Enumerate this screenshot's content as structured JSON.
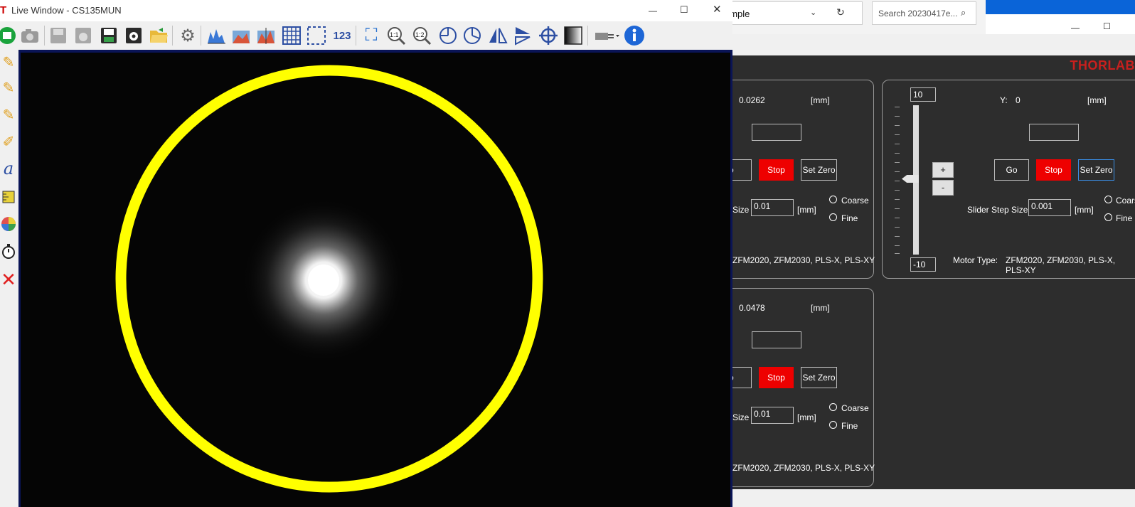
{
  "live_window": {
    "title": "Live Window - CS135MUN",
    "app_icon": "T",
    "controls": {
      "minimize": "—",
      "maximize": "☐",
      "close": "✕"
    },
    "toolbar_icons": [
      "start-live-icon",
      "snapshot-camera-icon",
      "save-disabled-icon",
      "save-sequence-disabled-icon",
      "save-image-icon",
      "settings-save-icon",
      "open-folder-icon",
      "camera-settings-gear-icon",
      "histogram-icon",
      "image-profile-icon",
      "line-profile-icon",
      "grid-overlay-icon",
      "roi-select-icon",
      "numeric-display-icon",
      "fit-to-window-icon",
      "zoom-1-1-icon",
      "zoom-1-2-icon",
      "rotate-icon",
      "rotate-partial-icon",
      "flip-horizontal-icon",
      "flip-vertical-icon",
      "crosshair-icon",
      "grayscale-lut-icon",
      "plugin-connect-icon",
      "info-icon"
    ],
    "toolbar_text": {
      "zoom_1_1": "1:1",
      "zoom_1_2": "1:2",
      "numeric": "123"
    },
    "left_tools": [
      "pencil-icon",
      "pencil-2-icon",
      "pencil-3-icon",
      "compass-icon",
      "text-tool-icon",
      "ruler-icon",
      "color-wheel-icon",
      "stopwatch-icon",
      "delete-x-icon"
    ]
  },
  "background_window": {
    "address_text": "ample",
    "search_placeholder": "Search 20230417e...",
    "controls": {
      "minimize": "—",
      "maximize": "☐"
    }
  },
  "thorlabs": {
    "logo": "THORLAB",
    "axis_top_left": {
      "value": "0.0262",
      "unit": "[mm]",
      "target": "",
      "go": "o",
      "stop": "Stop",
      "set_zero": "Set Zero",
      "step_label": "Size",
      "step_value": "0.01",
      "step_unit": "[mm]",
      "coarse": "Coarse",
      "fine": "Fine",
      "motor_type": "ZFM2020, ZFM2030, PLS-X, PLS-XY"
    },
    "axis_bottom_left": {
      "value": "0.0478",
      "unit": "[mm]",
      "target": "",
      "go": "o",
      "stop": "Stop",
      "set_zero": "Set Zero",
      "step_label": "Size",
      "step_value": "0.01",
      "step_unit": "[mm]",
      "coarse": "Coarse",
      "fine": "Fine",
      "motor_type": "ZFM2020, ZFM2030, PLS-X, PLS-XY"
    },
    "axis_y": {
      "label": "Y:",
      "value": "0",
      "unit": "[mm]",
      "target": "",
      "slider_max": "10",
      "slider_min": "-10",
      "plus": "+",
      "minus": "-",
      "go": "Go",
      "stop": "Stop",
      "set_zero": "Set Zero",
      "step_label": "Slider Step Size",
      "step_value": "0.001",
      "step_unit": "[mm]",
      "coarse": "Coars",
      "fine": "Fine",
      "motor_type_label": "Motor Type:",
      "motor_type": "ZFM2020, ZFM2030, PLS-X, PLS-XY"
    }
  },
  "colors": {
    "stop": "#ee0000",
    "panel_bg": "#2d2d2d",
    "circle": "#ffff00",
    "logo": "#c8201e"
  }
}
